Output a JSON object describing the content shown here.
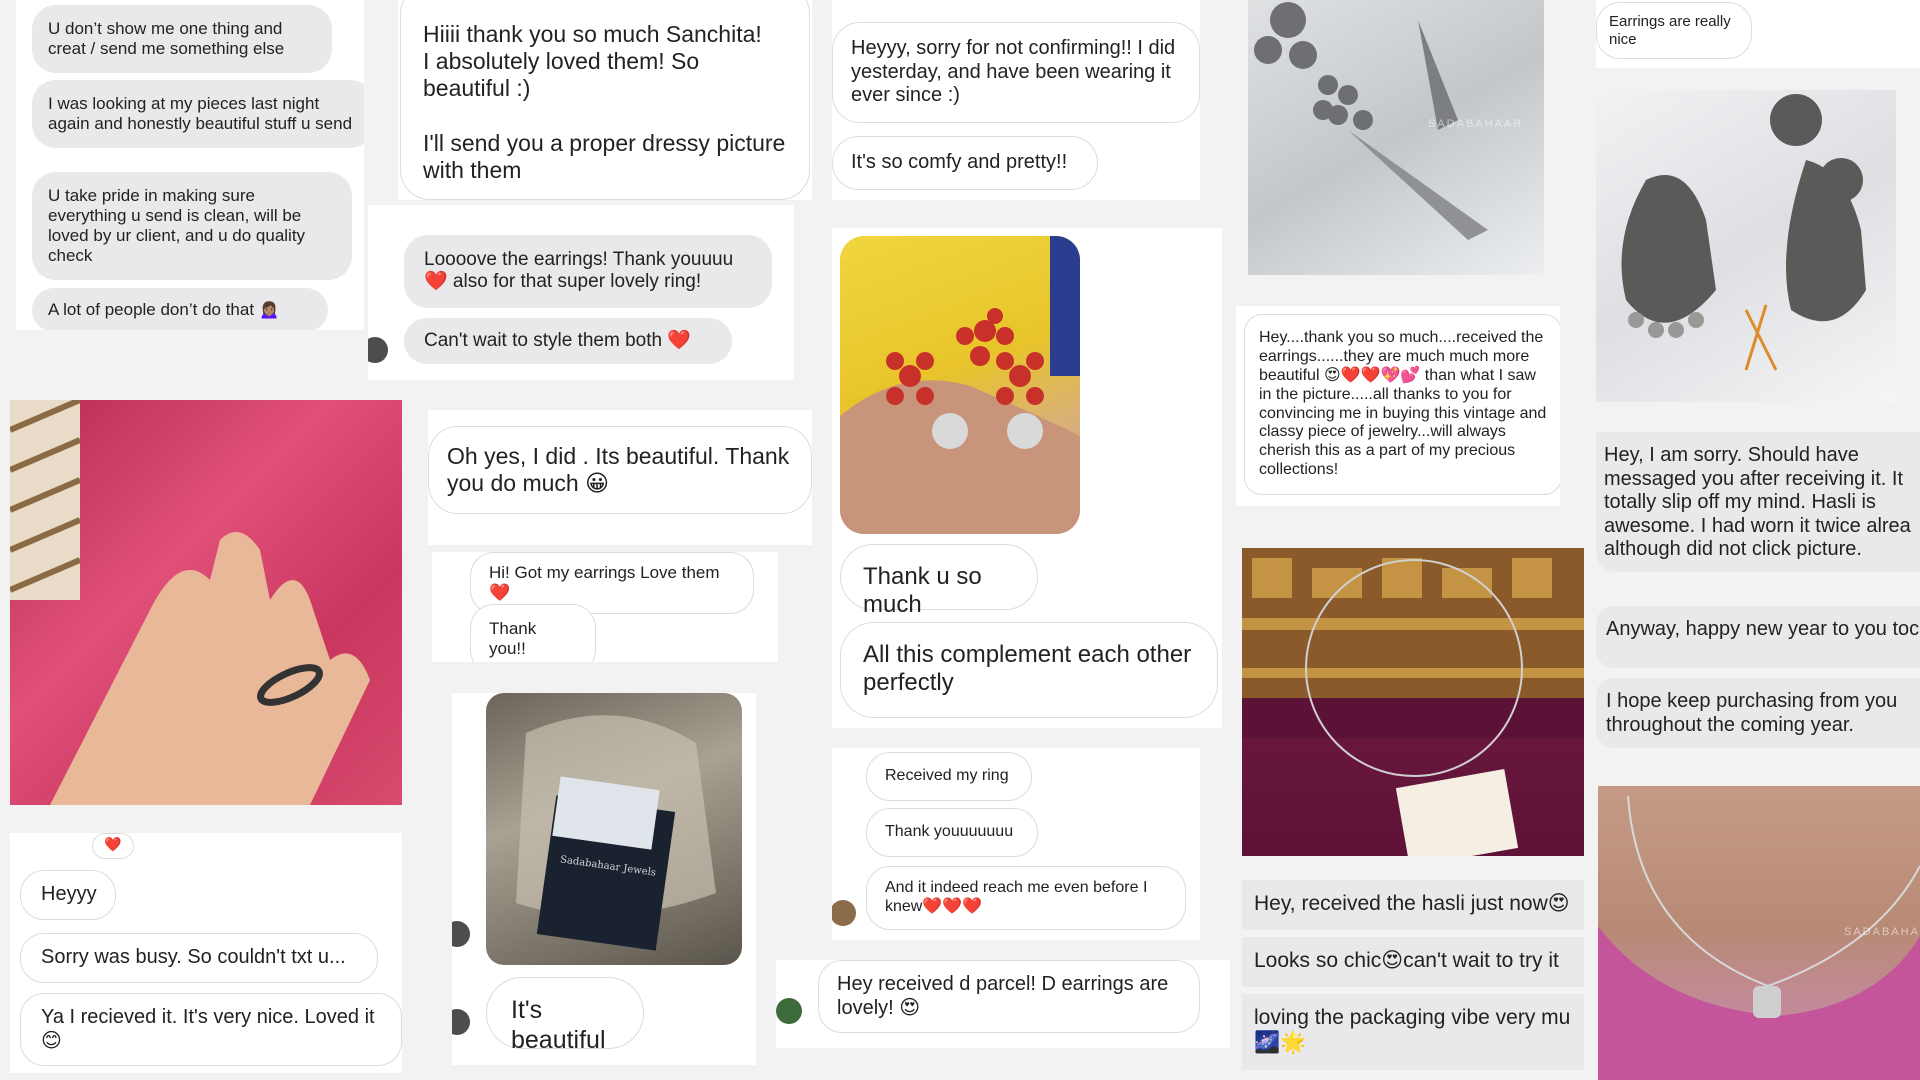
{
  "col1": {
    "m1": "U don’t show me one thing and creat / send me something else",
    "m2": "I was looking at my pieces last night again and honestly beautiful stuff u send",
    "m3": "U take pride in making sure everything u send is clean, will be loved by ur client, and u do quality check",
    "m4": "A lot of people don’t do that 🙍🏽‍♀️",
    "reaction": "❤️",
    "m5": "Heyyy",
    "m6": "Sorry was busy. So couldn't txt u...",
    "m7": "Ya I recieved it. It's very nice. Loved it 😊"
  },
  "col2": {
    "m1": "Hiiii thank you so much Sanchita!\nI absolutely loved them! So beautiful :)\n\nI'll send you a proper dressy picture with them",
    "m2": "Loooove the earrings! Thank youuuu ❤️ also for that super lovely ring!",
    "m3": "Can't wait to style them both ❤️",
    "m4": "Oh yes, I did . Its beautiful.  Thank you do much 😀",
    "m5": "Hi! Got my earrings Love them❤️",
    "m6": "Thank you!!",
    "m7": "It's beautiful",
    "card_brand": "Sadabahaar Jewels"
  },
  "col3": {
    "m1": "Heyyy, sorry for not confirming!! I did yesterday, and have been wearing it ever since :)",
    "m2": "It's so comfy and pretty!!",
    "m3": "Thank u so much",
    "m4": "All this complement each other perfectly",
    "m5": "Received my ring",
    "m6": "Thank youuuuuuu",
    "m7": "And it indeed reach me even before I knew❤️❤️❤️",
    "m8": "Hey received d parcel! D earrings are lovely! 😍"
  },
  "col4": {
    "watermark": "SADABAHAAR",
    "m1": "Hey....thank you so much....received the earrings......they are much much more beautiful 😍❤️❤️💖💕 than what I saw in the picture.....all thanks to you for convincing me in buying this vintage and classy piece of jewelry...will always cherish this as a part of my precious collections!",
    "m2": "Hey, received the hasli just now😍",
    "m3": "Looks so chic😍can't wait to try it",
    "m4": "loving the packaging vibe very mu",
    "m4b": "🌌🌟"
  },
  "col5": {
    "m1": "Earrings are really nice",
    "m2": "Hey, I am sorry. Should have messaged you after receiving it. It totally slip off my mind. Hasli is awesome. I had worn it twice alrea although did not click picture.",
    "m3": "Anyway, happy new year to you toc Hope you prosper manifold.",
    "m4": "I hope keep purchasing from you throughout the coming year.",
    "watermark": "SADABAHAAR"
  }
}
